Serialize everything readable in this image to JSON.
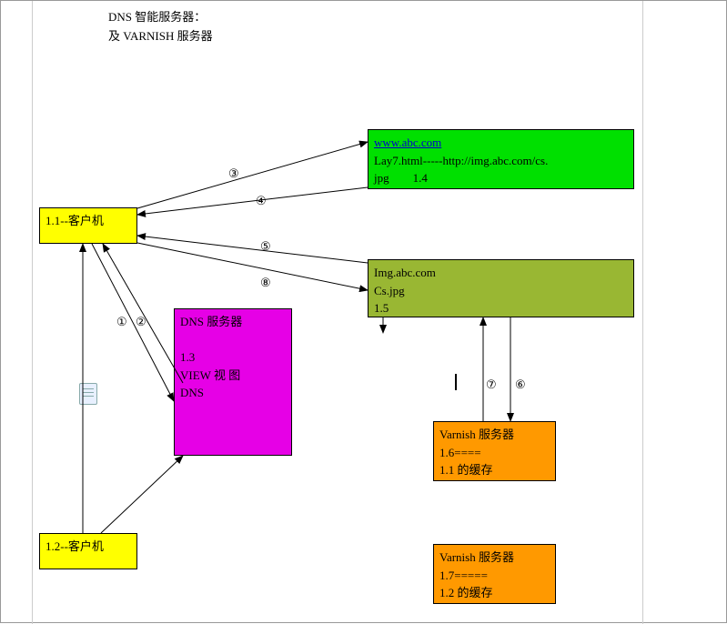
{
  "title": {
    "line1": "DNS 智能服务器：",
    "line2": "及 VARNISH 服务器"
  },
  "nodes": {
    "client1": {
      "label": "1.1--客户机"
    },
    "client2": {
      "label": "1.2--客户机"
    },
    "web": {
      "url": "www.abc.com",
      "line2a": "Lay7.html-----http://img.abc.com/cs.",
      "line3a": "jpg",
      "line3b": "1.4"
    },
    "img": {
      "line1": "Img.abc.com",
      "line2": "Cs.jpg",
      "line3": "1.5"
    },
    "dns": {
      "line1": "DNS 服务器",
      "line2": "1.3",
      "line3": "VIEW    视  图",
      "line4": "DNS"
    },
    "varnish1": {
      "line1": "Varnish 服务器",
      "line2": "1.6====",
      "line3": "1.1 的缓存"
    },
    "varnish2": {
      "line1": "Varnish 服务器",
      "line2": "1.7=====",
      "line3": "1.2 的缓存"
    }
  },
  "edge_labels": {
    "n1": "①",
    "n2": "②",
    "n3": "③",
    "n4": "④",
    "n5": "⑤",
    "n6": "⑥",
    "n7": "⑦",
    "n8": "⑧"
  }
}
